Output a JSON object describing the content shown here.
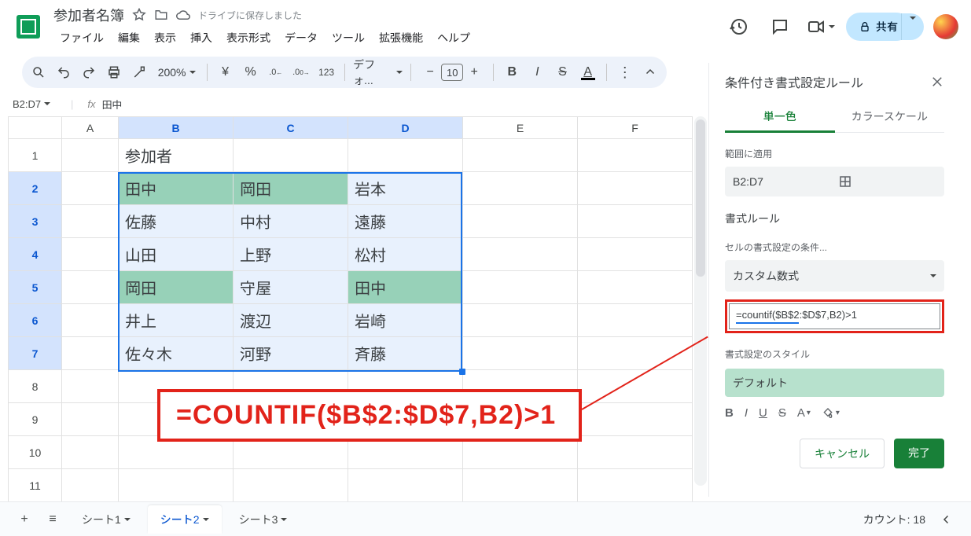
{
  "doc": {
    "title": "参加者名簿",
    "save_status": "ドライブに保存しました"
  },
  "menus": [
    "ファイル",
    "編集",
    "表示",
    "挿入",
    "表示形式",
    "データ",
    "ツール",
    "拡張機能",
    "ヘルプ"
  ],
  "share": {
    "label": "共有"
  },
  "toolbar": {
    "zoom": "200%",
    "currency_symbol": "¥",
    "percent": "%",
    "dec_minus": ".0",
    "dec_plus": ".00",
    "number_format": "123",
    "font": "デフォ...",
    "font_size": "10",
    "bold": "B",
    "italic": "I",
    "strike": "S",
    "color_a": "A"
  },
  "namebox": {
    "range": "B2:D7",
    "fx": "fx",
    "value": "田中"
  },
  "columns": [
    "A",
    "B",
    "C",
    "D",
    "E",
    "F"
  ],
  "rows": [
    "1",
    "2",
    "3",
    "4",
    "5",
    "6",
    "7",
    "8",
    "9",
    "10",
    "11"
  ],
  "header_cell": "参加者",
  "table": [
    [
      {
        "t": "田中",
        "hl": true
      },
      {
        "t": "岡田",
        "hl": true
      },
      {
        "t": "岩本",
        "hl": false
      }
    ],
    [
      {
        "t": "佐藤",
        "hl": false
      },
      {
        "t": "中村",
        "hl": false
      },
      {
        "t": "遠藤",
        "hl": false
      }
    ],
    [
      {
        "t": "山田",
        "hl": false
      },
      {
        "t": "上野",
        "hl": false
      },
      {
        "t": "松村",
        "hl": false
      }
    ],
    [
      {
        "t": "岡田",
        "hl": true
      },
      {
        "t": "守屋",
        "hl": false
      },
      {
        "t": "田中",
        "hl": true
      }
    ],
    [
      {
        "t": "井上",
        "hl": false
      },
      {
        "t": "渡辺",
        "hl": false
      },
      {
        "t": "岩崎",
        "hl": false
      }
    ],
    [
      {
        "t": "佐々木",
        "hl": false
      },
      {
        "t": "河野",
        "hl": false
      },
      {
        "t": "斉藤",
        "hl": false
      }
    ]
  ],
  "side_panel": {
    "title": "条件付き書式設定ルール",
    "tab_single": "単一色",
    "tab_scale": "カラースケール",
    "apply_range_label": "範囲に適用",
    "apply_range_value": "B2:D7",
    "rules_label": "書式ルール",
    "condition_label": "セルの書式設定の条件...",
    "condition_value": "カスタム数式",
    "formula_value": "=countif($B$2:$D$7,B2)>1",
    "style_label": "書式設定のスタイル",
    "style_preview": "デフォルト",
    "cancel": "キャンセル",
    "done": "完了"
  },
  "annotation": {
    "text": "=COUNTIF($B$2:$D$7,B2)>1"
  },
  "sheet_tabs": {
    "tabs": [
      "シート1",
      "シート2",
      "シート3"
    ],
    "active_index": 1,
    "count_label": "カウント: 18"
  }
}
